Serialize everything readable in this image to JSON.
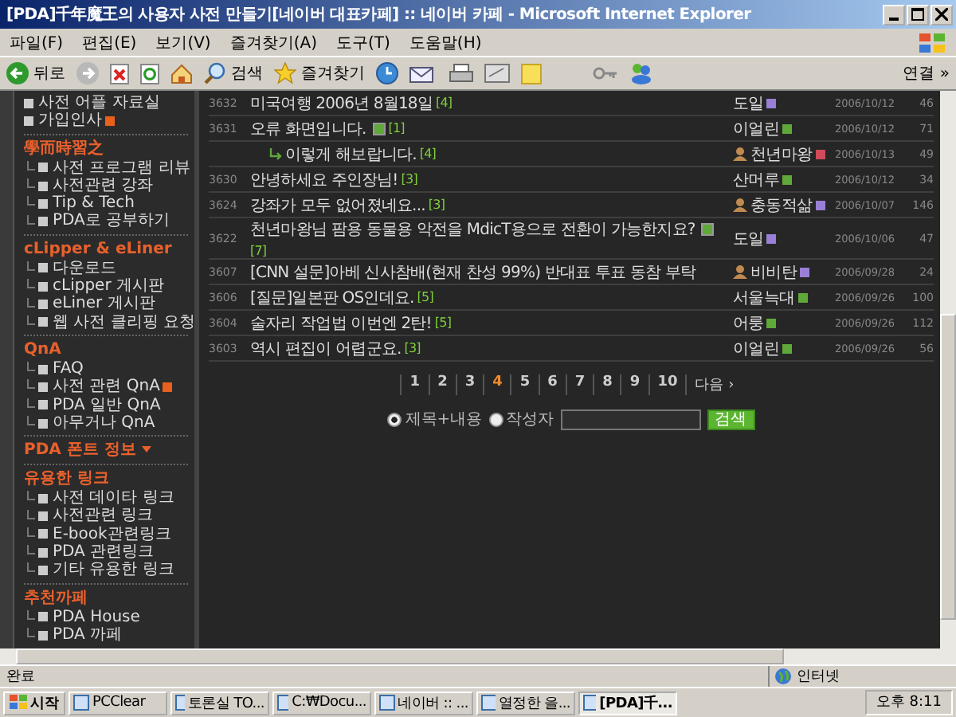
{
  "window": {
    "title": "[PDA]千年魔王의 사용자 사전 만들기[네이버 대표카페] :: 네이버 카페 - Microsoft Internet Explorer"
  },
  "menu": [
    "파일(F)",
    "편집(E)",
    "보기(V)",
    "즐겨찾기(A)",
    "도구(T)",
    "도움말(H)"
  ],
  "toolbar": {
    "back": "뒤로",
    "search": "검색",
    "favorites": "즐겨찾기",
    "links": "연결 »"
  },
  "sidebar": {
    "top_items": [
      {
        "label": "사전 어플 자료실"
      },
      {
        "label": "가입인사",
        "new": true
      }
    ],
    "sections": [
      {
        "title": "學而時習之",
        "children": [
          {
            "label": "사전 프로그램 리뷰"
          },
          {
            "label": "사전관련 강좌"
          },
          {
            "label": "Tip & Tech"
          },
          {
            "label": "PDA로 공부하기"
          }
        ]
      },
      {
        "title": "cLipper & eLiner",
        "children": [
          {
            "label": "다운로드"
          },
          {
            "label": "cLipper 게시판"
          },
          {
            "label": "eLiner 게시판"
          },
          {
            "label": "웹 사전 클리핑 요청"
          }
        ]
      },
      {
        "title": "QnA",
        "children": [
          {
            "label": "FAQ"
          },
          {
            "label": "사전 관련 QnA",
            "new": true
          },
          {
            "label": "PDA 일반 QnA"
          },
          {
            "label": "아무거나 QnA"
          }
        ]
      },
      {
        "title": "PDA 폰트 정보",
        "link": true
      },
      {
        "title": "유용한 링크",
        "children": [
          {
            "label": "사전 데이타 링크"
          },
          {
            "label": "사전관련 링크"
          },
          {
            "label": "E-book관련링크"
          },
          {
            "label": "PDA 관련링크"
          },
          {
            "label": "기타 유용한 링크"
          }
        ]
      },
      {
        "title": "추천까페",
        "children": [
          {
            "label": "PDA House"
          },
          {
            "label": "PDA 까페"
          }
        ]
      }
    ]
  },
  "posts": [
    {
      "number": "3632",
      "title": "미국여행 2006년 8월18일",
      "comments": "[4]",
      "author": "도일",
      "color": "#9a7fd6",
      "date": "2006/10/12",
      "views": "46"
    },
    {
      "number": "3631",
      "title": "오류 화면입니다.",
      "image": true,
      "comments": "[1]",
      "author": "이얼린",
      "color": "#5fa83a",
      "date": "2006/10/12",
      "views": "71"
    },
    {
      "title": "이렇게 해보랍니다.",
      "reply": true,
      "comments": "[4]",
      "author": "천년마왕",
      "avatar": true,
      "color": "#d04a5a",
      "date": "2006/10/13",
      "views": "49"
    },
    {
      "number": "3630",
      "title": "안녕하세요 주인장님!",
      "comments": "[3]",
      "author": "산머루",
      "color": "#5fa83a",
      "date": "2006/10/12",
      "views": "34"
    },
    {
      "number": "3624",
      "title": "강좌가 모두 없어졌네요...",
      "comments": "[3]",
      "author": "충동적삶",
      "avatar": true,
      "color": "#9a7fd6",
      "date": "2006/10/07",
      "views": "146"
    },
    {
      "number": "3622",
      "title": "천년마왕님 팜용 동물용 악전을 MdicT용으로 전환이 가능한지요?",
      "image": true,
      "comments": "[7]",
      "author": "도일",
      "color": "#9a7fd6",
      "date": "2006/10/06",
      "views": "47"
    },
    {
      "number": "3607",
      "title": "[CNN 설문]아베 신사참배(현재 찬성 99%) 반대표 투표 동참 부탁",
      "author": "비비탄",
      "avatar": true,
      "color": "#9a7fd6",
      "date": "2006/09/28",
      "views": "24"
    },
    {
      "number": "3606",
      "title": "[질문]일본판 OS인데요.",
      "comments": "[5]",
      "author": "서울늑대",
      "color": "#5fa83a",
      "date": "2006/09/26",
      "views": "100"
    },
    {
      "number": "3604",
      "title": "술자리 작업법 이번엔 2탄!",
      "comments": "[5]",
      "author": "어룽",
      "color": "#5fa83a",
      "date": "2006/09/26",
      "views": "112"
    },
    {
      "number": "3603",
      "title": "역시 편집이 어렵군요.",
      "comments": "[3]",
      "author": "이얼린",
      "color": "#5fa83a",
      "date": "2006/09/26",
      "views": "56"
    }
  ],
  "pages": [
    {
      "label": "1",
      "selected": false
    },
    {
      "label": "2",
      "selected": false
    },
    {
      "label": "3",
      "selected": false
    },
    {
      "label": "4",
      "selected": true
    },
    {
      "label": "5",
      "selected": false
    },
    {
      "label": "6",
      "selected": false
    },
    {
      "label": "7",
      "selected": false
    },
    {
      "label": "8",
      "selected": false
    },
    {
      "label": "9",
      "selected": false
    },
    {
      "label": "10",
      "selected": false
    }
  ],
  "next_page": "다음 ›",
  "search_form": {
    "options": [
      {
        "label": "제목+내용",
        "selected": true
      },
      {
        "label": "작성자",
        "selected": false
      }
    ],
    "button": "검색"
  },
  "status_bar": {
    "text": "완료",
    "zone": "인터넷"
  },
  "taskbar": {
    "start": "시작",
    "tasks": [
      {
        "label": "PCClear",
        "selected": false
      },
      {
        "label": "토론실 TO...",
        "selected": false
      },
      {
        "label": "C:₩Docu...",
        "selected": false
      },
      {
        "label": "네이버 :: ...",
        "selected": false
      },
      {
        "label": "열정한 을...",
        "selected": false
      },
      {
        "label": "[PDA]千...",
        "selected": true
      }
    ],
    "clock": "오후 8:11"
  }
}
